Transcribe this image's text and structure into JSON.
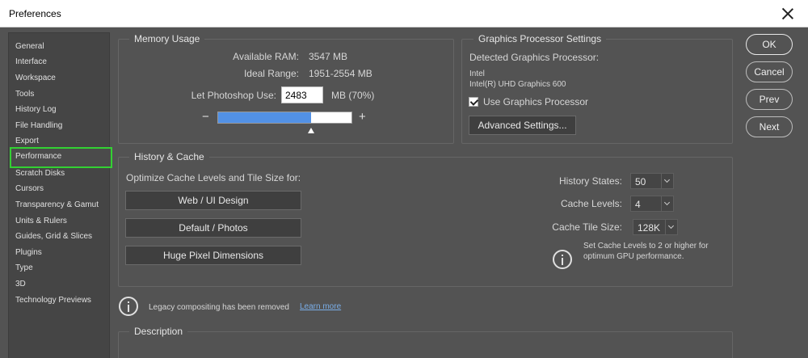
{
  "window": {
    "title": "Preferences"
  },
  "sidebar": {
    "items": [
      {
        "label": "General"
      },
      {
        "label": "Interface"
      },
      {
        "label": "Workspace"
      },
      {
        "label": "Tools"
      },
      {
        "label": "History Log"
      },
      {
        "label": "File Handling"
      },
      {
        "label": "Export"
      },
      {
        "label": "Performance"
      },
      {
        "label": "Scratch Disks"
      },
      {
        "label": "Cursors"
      },
      {
        "label": "Transparency & Gamut"
      },
      {
        "label": "Units & Rulers"
      },
      {
        "label": "Guides, Grid & Slices"
      },
      {
        "label": "Plugins"
      },
      {
        "label": "Type"
      },
      {
        "label": "3D"
      },
      {
        "label": "Technology Previews"
      }
    ],
    "selected": "Performance",
    "highlight_color": "#33d133"
  },
  "memory": {
    "title": "Memory Usage",
    "available_label": "Available RAM:",
    "available_value": "3547 MB",
    "ideal_label": "Ideal Range:",
    "ideal_value": "1951-2554 MB",
    "use_label": "Let Photoshop Use:",
    "use_value": "2483",
    "use_unit": "MB (70%)",
    "minus": "−",
    "plus": "+",
    "slider_fraction": 0.7
  },
  "gpu": {
    "title": "Graphics Processor Settings",
    "detected_label": "Detected Graphics Processor:",
    "vendor": "Intel",
    "model": "Intel(R) UHD Graphics 600",
    "use_label": "Use Graphics Processor",
    "use_checked": true,
    "advanced_label": "Advanced Settings..."
  },
  "history": {
    "title": "History & Cache",
    "optimize_label": "Optimize Cache Levels and Tile Size for:",
    "web_button": "Web / UI Design",
    "default_button": "Default / Photos",
    "huge_button": "Huge Pixel Dimensions",
    "states_label": "History States:",
    "states_value": "50",
    "levels_label": "Cache Levels:",
    "levels_value": "4",
    "tile_label": "Cache Tile Size:",
    "tile_value": "128K",
    "note_line1": "Set Cache Levels to 2 or higher for",
    "note_line2": "optimum GPU performance."
  },
  "legacy": {
    "text": "Legacy compositing has been removed",
    "link": "Learn more"
  },
  "description": {
    "title": "Description"
  },
  "buttons": {
    "ok": "OK",
    "cancel": "Cancel",
    "prev": "Prev",
    "next": "Next"
  }
}
